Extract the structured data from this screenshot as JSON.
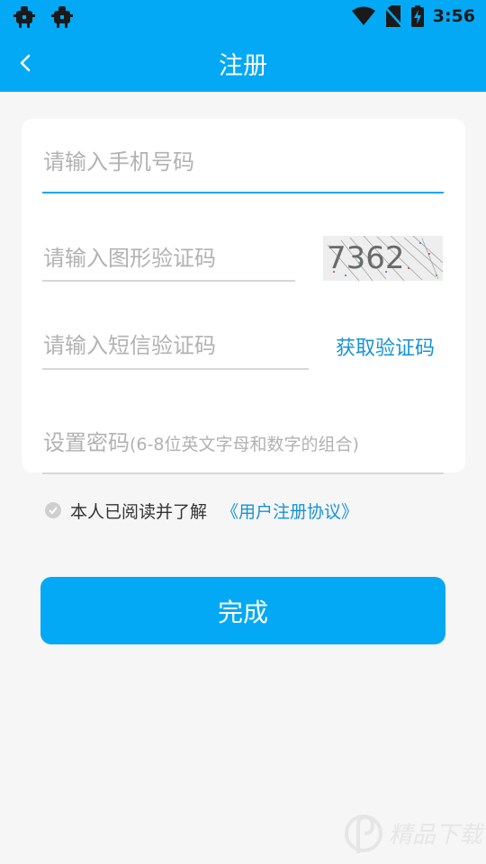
{
  "status_bar": {
    "time": "3:56",
    "icons": [
      "bug-icon",
      "bug-icon",
      "wifi-icon",
      "no-sim-icon",
      "battery-charging-icon"
    ]
  },
  "app_bar": {
    "title": "注册",
    "back_icon": "chevron-left-icon"
  },
  "form": {
    "phone_placeholder": "请输入手机号码",
    "captcha_placeholder": "请输入图形验证码",
    "captcha_code": "7362",
    "sms_placeholder": "请输入短信验证码",
    "sms_button": "获取验证码",
    "password_placeholder": "设置密码",
    "password_hint": "(6-8位英文字母和数字的组合)"
  },
  "agreement": {
    "text": "本人已阅读并了解",
    "link": "《用户注册协议》",
    "checked": true
  },
  "submit_label": "完成",
  "watermark": {
    "text": "精品下载"
  },
  "colors": {
    "primary": "#03a9f4",
    "link": "#1793d6",
    "placeholder": "#b2b2b2",
    "background": "#f6f6f6"
  }
}
